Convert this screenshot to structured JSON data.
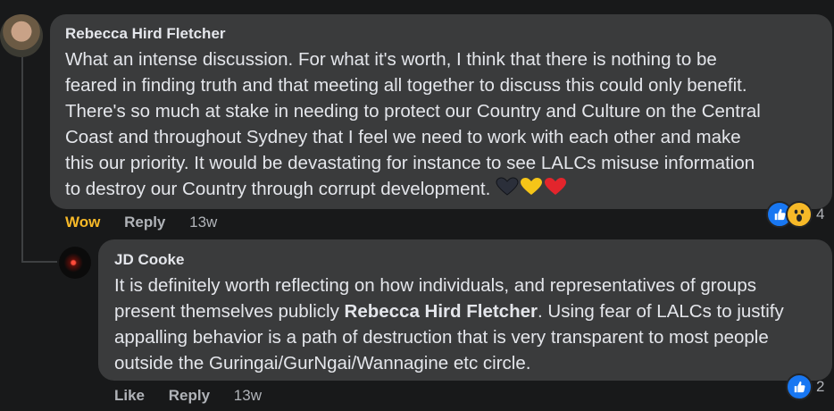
{
  "comments": [
    {
      "author": "Rebecca Hird Fletcher",
      "lines": [
        "What an intense discussion. For what it's worth, I think that there is nothing to be",
        "feared in finding truth and that meeting all together to discuss this could only benefit.",
        "There's so much at stake in needing to protect our Country and Culture on the Central",
        "Coast and throughout Sydney that I feel we need to work with each other and make",
        "this our priority. It would be devastating for instance to see LALCs misuse information",
        "to destroy our Country through corrupt development."
      ],
      "emoji_hearts": [
        "black-heart",
        "yellow-heart",
        "red-heart"
      ],
      "reaction_action": "Wow",
      "reply_label": "Reply",
      "time": "13w",
      "reaction_icons": [
        "like-icon",
        "wow-icon"
      ],
      "reaction_count": "4"
    },
    {
      "author": "JD Cooke",
      "line1": "It is definitely worth reflecting on how individuals, and representatives of groups",
      "line2_pre": "present themselves publicly ",
      "line2_mention": "Rebecca Hird Fletcher",
      "line2_post": ". Using fear of LALCs to justify",
      "line3": "appalling behavior is a path of destruction that is very transparent to most people",
      "line4": "outside the Guringai/GurNgai/Wannagine etc circle.",
      "like_label": "Like",
      "reply_label": "Reply",
      "time": "13w",
      "reaction_icons": [
        "like-icon"
      ],
      "reaction_count": "2"
    }
  ],
  "colors": {
    "background": "#18191a",
    "bubble": "#3a3b3c",
    "text": "#e4e6eb",
    "muted": "#b0b3b8",
    "wow": "#f7b928",
    "like": "#1877f2"
  }
}
